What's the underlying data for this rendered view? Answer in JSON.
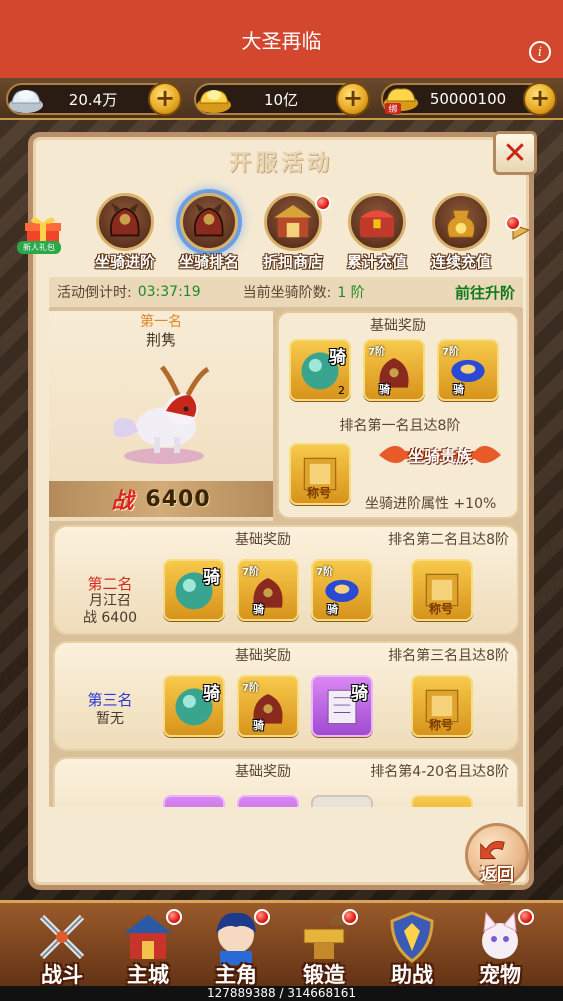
{
  "header": {
    "title": "大圣再临",
    "info_icon": "info-icon"
  },
  "resources": [
    {
      "icon": "silver-ingot-icon",
      "value": "20.4万"
    },
    {
      "icon": "gold-ingot-icon",
      "value": "10亿"
    },
    {
      "icon": "bound-gold-icon",
      "value": "50000100",
      "bound_label": "绑"
    }
  ],
  "panel": {
    "title": "开服活动",
    "gift_label": "新人礼包",
    "tabs": [
      {
        "label": "坐骑进阶",
        "icon": "mount-armor-icon",
        "active": false
      },
      {
        "label": "坐骑排名",
        "icon": "mount-armor-icon",
        "active": true
      },
      {
        "label": "折扣商店",
        "icon": "shop-icon",
        "active": false
      },
      {
        "label": "累计充值",
        "icon": "treasure-chest-icon",
        "active": false
      },
      {
        "label": "连续充值",
        "icon": "gold-pouch-icon",
        "active": false
      }
    ],
    "countdown_label": "活动倒计时:",
    "countdown_value": "03:37:19",
    "mount_level_label": "当前坐骑阶数:",
    "mount_level_value": "1 阶",
    "goto_upgrade": "前往升阶",
    "first": {
      "rank": "第一名",
      "name": "荆隽",
      "power_label": "战",
      "power_value": "6400",
      "reward_header": "基础奖励",
      "items": [
        {
          "icon": "mount-stone-icon",
          "qi": "骑",
          "count": "2"
        },
        {
          "icon": "mount-armor-icon",
          "tag": "7阶",
          "qi": "骑"
        },
        {
          "icon": "mount-harness-icon",
          "tag": "7阶",
          "qi": "骑"
        }
      ],
      "condition": "排名第一名且达8阶",
      "title_badge": "坐骑贵族",
      "title_item_icon": "title-scroll-icon",
      "title_item_word": "称号",
      "bonus": "坐骑进阶属性 +10%"
    },
    "rows": [
      {
        "rank": "第二名",
        "rank_color": "#d62a1e",
        "name": "月江召",
        "power": "战 6400",
        "reward_header": "基础奖励",
        "condition": "排名第二名且达8阶",
        "items": [
          {
            "icon": "mount-stone-icon",
            "qi": "骑"
          },
          {
            "icon": "mount-armor-icon",
            "tag": "7阶",
            "qi": "骑"
          },
          {
            "icon": "mount-harness-icon",
            "tag": "7阶",
            "qi": "骑"
          }
        ],
        "title_item_word": "称号"
      },
      {
        "rank": "第三名",
        "rank_color": "#2a3ad6",
        "name": "暂无",
        "power": "",
        "reward_header": "基础奖励",
        "condition": "排名第三名且达8阶",
        "items": [
          {
            "icon": "mount-stone-icon",
            "qi": "骑"
          },
          {
            "icon": "mount-armor-icon",
            "tag": "7阶",
            "qi": "骑"
          },
          {
            "icon": "skill-scroll-icon",
            "qi": "骑",
            "purple": true
          }
        ],
        "title_item_word": "称号"
      },
      {
        "rank": "",
        "name": "",
        "power": "",
        "reward_header": "基础奖励",
        "condition": "排名第4-20名且达8阶"
      }
    ],
    "return_label": "返回"
  },
  "bottom_nav": [
    {
      "label": "战斗",
      "icon": "crossed-swords-icon"
    },
    {
      "label": "主城",
      "icon": "castle-icon"
    },
    {
      "label": "主角",
      "icon": "hero-avatar-icon"
    },
    {
      "label": "锻造",
      "icon": "anvil-icon"
    },
    {
      "label": "助战",
      "icon": "shield-icon"
    },
    {
      "label": "宠物",
      "icon": "pet-cat-icon"
    }
  ],
  "exp": {
    "text": "127889388 / 314668161",
    "fraction": 0.406
  },
  "colors": {
    "title_bar": "#d3472f",
    "accent_green": "#1c8a2a",
    "rank_red": "#d62a1e",
    "rank_blue": "#2a3ad6"
  }
}
